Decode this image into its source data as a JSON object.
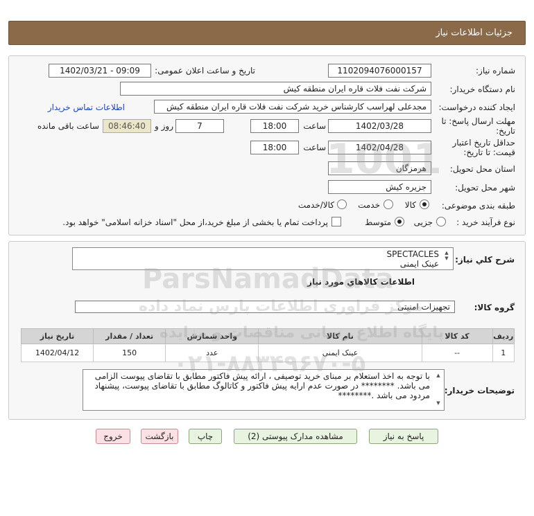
{
  "header": {
    "title": "جزئیات اطلاعات نیاز"
  },
  "form": {
    "need_number": {
      "label": "شماره نیاز:",
      "value": "1102094076000157"
    },
    "announce": {
      "label": "تاریخ و ساعت اعلان عمومی:",
      "value": "1402/03/21 - 09:09"
    },
    "buyer": {
      "label": "نام دستگاه خریدار:",
      "value": "شرکت نفت فلات قاره ایران منطقه کیش"
    },
    "requester": {
      "label": "ایجاد کننده درخواست:",
      "value": "مجدعلی لهراسب کارشناس خرید شرکت نفت فلات قاره ایران منطقه کیش",
      "contact_link": "اطلاعات تماس خریدار"
    },
    "deadline": {
      "label_line1": "مهلت ارسال پاسخ: تا",
      "label_line2": "تاریخ:",
      "date": "1402/03/28",
      "time_label": "ساعت",
      "time": "18:00",
      "days": "7",
      "days_label": "روز و",
      "remaining": "08:46:40",
      "remaining_label": "ساعت باقی مانده"
    },
    "validity": {
      "label_line1": "حداقل تاریخ اعتبار",
      "label_line2": "قیمت: تا تاریخ:",
      "date": "1402/04/28",
      "time_label": "ساعت",
      "time": "18:00"
    },
    "province": {
      "label": "استان محل تحویل:",
      "value": "هرمزگان"
    },
    "city": {
      "label": "شهر محل تحویل:",
      "value": "جزیره کیش"
    },
    "category": {
      "label": "طبقه بندی موضوعی:",
      "options": [
        "کالا",
        "خدمت",
        "کالا/خدمت"
      ],
      "selected": "کالا"
    },
    "process": {
      "label": "نوع فرآیند خرید :",
      "options": [
        "جزیی",
        "متوسط"
      ],
      "selected": "متوسط",
      "note": "پرداخت تمام یا بخشی از مبلغ خرید،از محل \"اسناد خزانه اسلامی\" خواهد بود."
    }
  },
  "summary": {
    "label": "شرح کلي نياز:",
    "line1": "SPECTACLES",
    "line2": "عینک ایمنی"
  },
  "goods": {
    "section_title": "اطلاعات کالاهاي مورد نياز",
    "group_label": "گروه کالا:",
    "group_value": "تجهیزات امنیتی",
    "columns": [
      "ردیف",
      "کد کالا",
      "نام کالا",
      "واحد شمارش",
      "تعداد / مقدار",
      "تاریخ نیاز"
    ],
    "rows": [
      [
        "1",
        "--",
        "عینک ایمنی",
        "عدد",
        "150",
        "1402/04/12"
      ]
    ]
  },
  "buyer_notes": {
    "label": "توضیحات خریدار:",
    "text": "با توجه به اخذ استعلام بر مبنای خرید توصیفی ، ارائه پیش فاکتور مطابق با تقاضای پیوست الزامی می باشد. ******** در صورت عدم ارایه پیش فاکتور و کاتالوگ مطابق با تقاضای پیوست، پیشنهاد مردود می باشد .********"
  },
  "buttons": {
    "reply": "پاسخ به نیاز",
    "attachments": "مشاهده مدارک پیوستی (2)",
    "print": "چاپ",
    "back": "بازگشت",
    "exit": "خروج"
  },
  "watermark": {
    "brand": "ParsNamadData",
    "phone": "۰۲۱-۸۸۳۴۹۶۷۰-۵",
    "line1": "مرکز فراوری اطلاعات پارس نماد داده",
    "line2": "پایگاه اطلاع رسانی مناقصات و مزایده",
    "number": "1001"
  },
  "colors": {
    "header_bg": "#8b6a4a",
    "button_green": "#e8f3e0",
    "button_red": "#fbe1e4",
    "link": "#1a44c2"
  }
}
